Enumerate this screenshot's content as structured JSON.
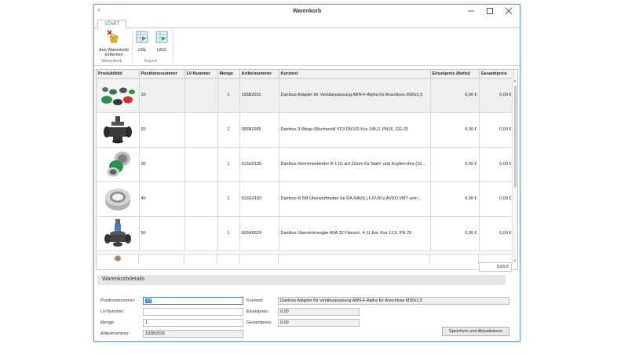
{
  "window": {
    "title": "Warenkorb",
    "app_icon": "×"
  },
  "ribbon": {
    "tab": "START",
    "remove_label_1": "Aus Warenkorb",
    "remove_label_2": "entfernen",
    "ugl_label": "UGL",
    "ugs_label": "UGS",
    "group_warenkorb": "Warenkorb",
    "group_export": "Export"
  },
  "table": {
    "headers": [
      "Produktbild",
      "Positionsnummer",
      "LV-Nummer",
      "Menge",
      "Artikelnummer",
      "Kurztext",
      "Einzelpreis (Netto)",
      "Gesamtpreis"
    ],
    "rows": [
      {
        "pos": "10",
        "lv": "",
        "menge": "1",
        "artikel": "193B2032",
        "kurztext": "Danfoss Adapter für Ventilanpassung ABN-F-Alpha für Anschluss M30x1,5",
        "einzel": "0,00 €",
        "gesamt": "0,00 €"
      },
      {
        "pos": "20",
        "lv": "",
        "menge": "1",
        "artikel": "065B1685",
        "kurztext": "Danfoss 3-Wege-Mischventil VF3 DN100 Kvs 145,0, PN16, GG-25",
        "einzel": "0,00 €",
        "gesamt": "0,00 €"
      },
      {
        "pos": "30",
        "lv": "",
        "menge": "1",
        "artikel": "013U0135",
        "kurztext": "Danfoss Klemmverbinder R 1 IG auf 22mm für Stahl- und Kupferrohre (10...",
        "einzel": "0,00 €",
        "gesamt": "0,00 €"
      },
      {
        "pos": "40",
        "lv": "",
        "menge": "1",
        "artikel": "013G3182",
        "kurztext": "Danfoss R 5/8 Überwurfmutter für RA,RAV(L),FJV,RLV,AVDO,VMT vern...",
        "einzel": "0,00 €",
        "gesamt": "0,00 €"
      },
      {
        "pos": "50",
        "lv": "",
        "menge": "1",
        "artikel": "003H6629",
        "kurztext": "Danfoss Überströmregler AVA 32 Flansch, 4-11 bar, Kvs 12,5, PN 25",
        "einzel": "0,00 €",
        "gesamt": "0,00 €"
      }
    ],
    "total": "0,00 €"
  },
  "details": {
    "title": "Warenkorbdetails",
    "labels": {
      "positionsnummer": "Positionsnummer:",
      "lv_nummer": "LV-Nummer:",
      "menge": "Menge:",
      "artikelnummer": "Artikelnummer:",
      "kurztext": "Kurztext:",
      "einzelpreis": "Einzelpreis:",
      "gesamtpreis": "Gesamtpreis:"
    },
    "values": {
      "positionsnummer": "10",
      "lv_nummer": "",
      "menge": "1",
      "artikelnummer": "193B2032",
      "kurztext": "Danfoss Adapter für Ventilanpassung ABN-F-Alpha für Anschluss M30x1,5",
      "einzelpreis": "0,00",
      "gesamtpreis": "0,00"
    },
    "save_button": "Speichern und Aktualisieren"
  },
  "colors": {
    "accent": "#3f7fd1",
    "tab_text": "#2a6fc9",
    "selected_row": "#f0f0f0"
  }
}
